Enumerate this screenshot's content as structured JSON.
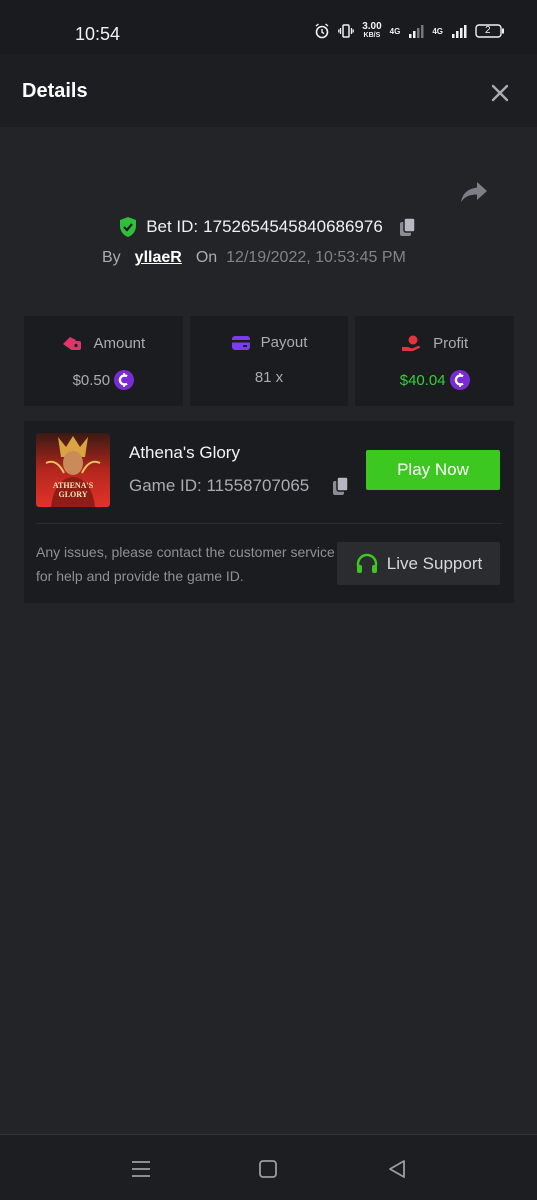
{
  "status_bar": {
    "time": "10:54",
    "net_speed_value": "3.00",
    "net_speed_unit": "KB/S",
    "network_1": "4G",
    "network_2": "4G",
    "battery": "2"
  },
  "header": {
    "title": "Details"
  },
  "bet": {
    "label": "Bet ID:",
    "id": "1752654545840686976",
    "by_label": "By",
    "user": "yllaeR",
    "on_label": "On",
    "date": "12/19/2022, 10:53:45 PM"
  },
  "stats": {
    "amount": {
      "label": "Amount",
      "value": "$0.50"
    },
    "payout": {
      "label": "Payout",
      "value": "81 x"
    },
    "profit": {
      "label": "Profit",
      "value": "$40.04"
    }
  },
  "game": {
    "name": "Athena's Glory",
    "id_label": "Game ID:",
    "id": "11558707065",
    "thumbnail_text_1": "ATHENA'S",
    "thumbnail_text_2": "GLORY",
    "play_label": "Play Now",
    "support_text": "Any issues, please contact the customer service for help and provide the game ID.",
    "support_label": "Live Support"
  },
  "colors": {
    "background": "#232427",
    "card": "#1b1c1f",
    "accent_green": "#3dc721",
    "profit_green": "#36cf3d",
    "coin_purple": "#7b2bd6"
  },
  "icons": [
    "alarm-icon",
    "vibrate-icon",
    "signal-icon",
    "battery-icon",
    "close-icon",
    "share-icon",
    "shield-check-icon",
    "copy-icon",
    "amount-icon",
    "wallet-icon",
    "profit-icon",
    "coin-icon",
    "headset-icon",
    "menu-icon",
    "home-icon",
    "back-icon"
  ]
}
